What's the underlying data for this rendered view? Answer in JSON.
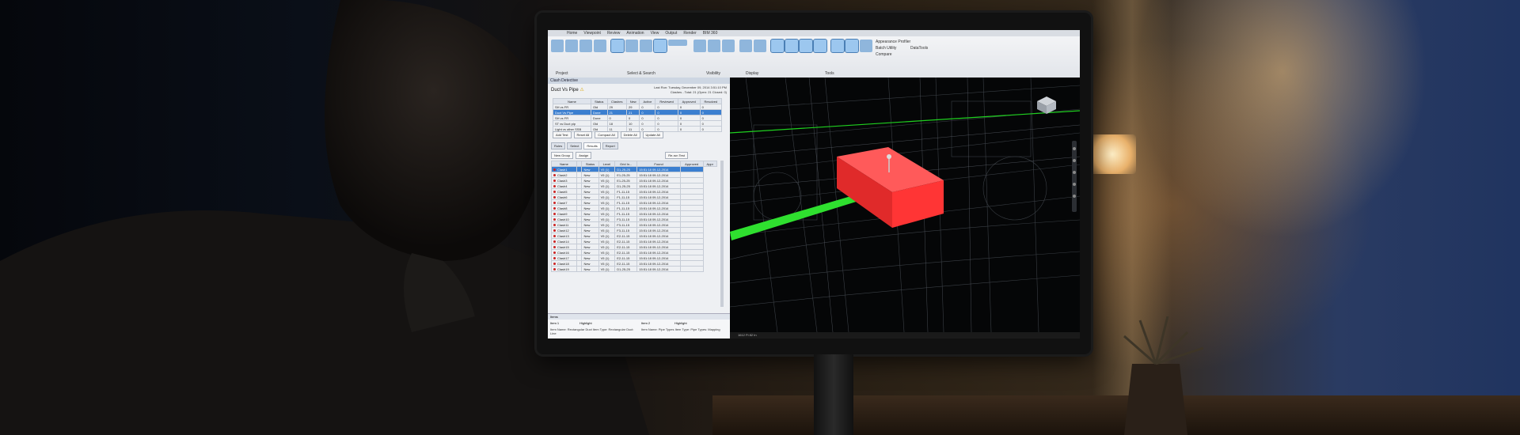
{
  "app": {
    "ribbon_tabs": [
      "Home",
      "Viewpoint",
      "Review",
      "Animation",
      "View",
      "Output",
      "Render",
      "BIM 360"
    ],
    "ribbon_groups": [
      "Project",
      "Select & Search",
      "Visibility",
      "Display",
      "Tools"
    ],
    "tool_labels": [
      "Append",
      "Refresh",
      "Reset All",
      "File Options",
      "Select",
      "Save Selection",
      "Select All",
      "Select Same",
      "Selection Tree",
      "Find Items",
      "Quick Find",
      "Sets",
      "Hide",
      "Require",
      "Hide Unselected",
      "Unhide All",
      "Links",
      "Quick Properties",
      "Properties",
      "Clash Detective",
      "TimeLiner",
      "Quantification",
      "Autodesk Rendering",
      "Animator",
      "Scripter",
      "Appearance Profiler",
      "Batch Utility",
      "Compare",
      "DataTools"
    ]
  },
  "clash_panel": {
    "title": "Clash Detective",
    "test_name": "Duct Vs Pipe",
    "last_run": "Last Run: Tuesday, December 09, 2014 3:51:10 PM",
    "summary": "Clashes - Total: 21 (Open: 21 Closed: 0)",
    "tests_headers": [
      "Name",
      "Status",
      "Clashes",
      "New",
      "Active",
      "Reviewed",
      "Approved",
      "Resolved"
    ],
    "tests_rows": [
      [
        "SH vs FR",
        "Old",
        "29",
        "29",
        "0",
        "0",
        "0",
        "0"
      ],
      [
        "Duct Vs Pipe",
        "Done",
        "21",
        "21",
        "0",
        "0",
        "0",
        "0"
      ],
      [
        "SH vs FR",
        "Done",
        "0",
        "0",
        "0",
        "0",
        "0",
        "0"
      ],
      [
        "ST vs Duct pip",
        "Old",
        "18",
        "10",
        "0",
        "0",
        "0",
        "0"
      ],
      [
        "Light vs other SSB",
        "Old",
        "11",
        "11",
        "0",
        "0",
        "0",
        "0"
      ]
    ],
    "selected_test": 1,
    "buttons": [
      "Add Test",
      "Reset All",
      "Compact All",
      "Delete All",
      "Update All"
    ],
    "tabs": [
      "Rules",
      "Select",
      "Results",
      "Report"
    ],
    "active_tab": "Results",
    "results_buttons": [
      "New Group",
      "Assign",
      "Re-run Test"
    ],
    "results_headers": [
      "Name",
      "",
      "Status",
      "Level",
      "Grid In...",
      "Found",
      "Approved",
      "Appr"
    ],
    "results_rows": [
      [
        "Clash1",
        "New",
        "V5 (1)",
        "D1-25-25",
        "15:51:18 09-12-2014"
      ],
      [
        "Clash2",
        "New",
        "V5 (1)",
        "E1-25-25",
        "15:51:18 09-12-2014"
      ],
      [
        "Clash3",
        "New",
        "V5 (1)",
        "E1-25-25",
        "15:51:18 09-12-2014"
      ],
      [
        "Clash4",
        "New",
        "V5 (1)",
        "D1-25-25",
        "15:51:18 09-12-2014"
      ],
      [
        "Clash5",
        "New",
        "V5 (1)",
        "F1-11-15",
        "15:51:18 09-12-2014"
      ],
      [
        "Clash6",
        "New",
        "V5 (1)",
        "F1-11-15",
        "15:51:18 09-12-2014"
      ],
      [
        "Clash7",
        "New",
        "V5 (1)",
        "F1-11-15",
        "15:51:18 09-12-2014"
      ],
      [
        "Clash8",
        "New",
        "V5 (1)",
        "F1-11-15",
        "15:51:18 09-12-2014"
      ],
      [
        "Clash9",
        "New",
        "V5 (1)",
        "F1-11-15",
        "15:51:18 09-12-2014"
      ],
      [
        "Clash10",
        "New",
        "V5 (1)",
        "F3-11-15",
        "15:51:18 09-12-2014"
      ],
      [
        "Clash11",
        "New",
        "V5 (1)",
        "F3-11-15",
        "15:51:18 09-12-2014"
      ],
      [
        "Clash12",
        "New",
        "V5 (1)",
        "F3-11-15",
        "15:51:18 09-12-2014"
      ],
      [
        "Clash13",
        "New",
        "V5 (1)",
        "E2-11-15",
        "15:51:18 09-12-2014"
      ],
      [
        "Clash14",
        "New",
        "V5 (1)",
        "E2-11-15",
        "15:51:18 09-12-2014"
      ],
      [
        "Clash15",
        "New",
        "V5 (1)",
        "E2-11-15",
        "15:51:18 09-12-2014"
      ],
      [
        "Clash16",
        "New",
        "V5 (1)",
        "E2-11-15",
        "15:51:18 09-12-2014"
      ],
      [
        "Clash17",
        "New",
        "V5 (1)",
        "E2-11-15",
        "15:51:18 09-12-2014"
      ],
      [
        "Clash18",
        "New",
        "V5 (1)",
        "E2-11-15",
        "15:51:18 09-12-2014"
      ],
      [
        "Clash19",
        "New",
        "V5 (1)",
        "D1-25-25",
        "15:51:18 09-12-2014"
      ]
    ],
    "items_label": "Items",
    "item1_label": "Item 1",
    "item2_label": "Item 2",
    "highlight_label": "Highlight",
    "item1_text": "Item Name: Rectangular Duct  Item Type: Rectangular Duct: Line",
    "item2_text": "Item Name: Pipe Types  Item Type: Pipe Types: Mapping"
  },
  "viewport": {
    "status_text": "1612 Ft 82 In"
  },
  "colors": {
    "clash_box": "#ff3b3b",
    "duct": "#31e031",
    "selection": "#3b7fd0"
  }
}
